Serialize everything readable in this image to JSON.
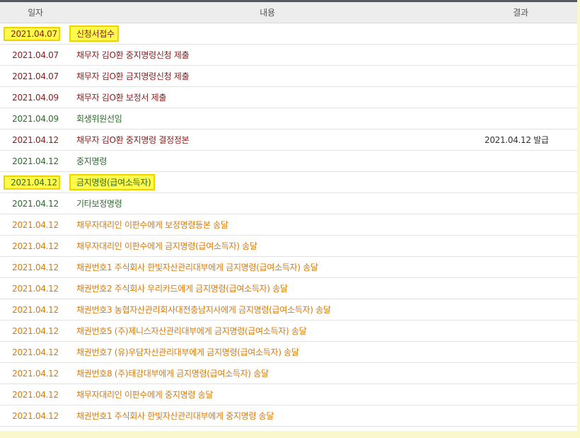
{
  "header": {
    "date": "일자",
    "content": "내용",
    "result": "결과"
  },
  "colors": {
    "red": "#8b1a1a",
    "green": "#2c6b2c",
    "orange": "#d97a0a",
    "highlight": "#fffb4a"
  },
  "rows": [
    {
      "date": "2021.04.07",
      "content": "신청서접수",
      "result": "",
      "color": "red",
      "highlighted": true
    },
    {
      "date": "2021.04.07",
      "content": "채무자 김O환 중지명령신청 제출",
      "result": "",
      "color": "red",
      "highlighted": false
    },
    {
      "date": "2021.04.07",
      "content": "채무자 김O환 금지명령신청 제출",
      "result": "",
      "color": "red",
      "highlighted": false
    },
    {
      "date": "2021.04.09",
      "content": "채무자 김O환 보정서 제출",
      "result": "",
      "color": "red",
      "highlighted": false
    },
    {
      "date": "2021.04.09",
      "content": "회생위원선임",
      "result": "",
      "color": "green",
      "highlighted": false
    },
    {
      "date": "2021.04.12",
      "content": "채무자 김O환 중지명령 결정정본",
      "result": "2021.04.12 발급",
      "color": "red",
      "highlighted": false
    },
    {
      "date": "2021.04.12",
      "content": "중지명령",
      "result": "",
      "color": "green",
      "highlighted": false
    },
    {
      "date": "2021.04.12",
      "content": "금지명령(급여소득자)",
      "result": "",
      "color": "green",
      "highlighted": true
    },
    {
      "date": "2021.04.12",
      "content": "기타보정명령",
      "result": "",
      "color": "green",
      "highlighted": false
    },
    {
      "date": "2021.04.12",
      "content": "채무자대리인 이판수에게 보정명령등본 송달",
      "result": "",
      "color": "orange",
      "highlighted": false
    },
    {
      "date": "2021.04.12",
      "content": "채무자대리인 이판수에게 금지명령(급여소득자) 송달",
      "result": "",
      "color": "orange",
      "highlighted": false
    },
    {
      "date": "2021.04.12",
      "content": "채권번호1 주식회사 한빛자산관리대부에게 금지명령(급여소득자) 송달",
      "result": "",
      "color": "orange",
      "highlighted": false
    },
    {
      "date": "2021.04.12",
      "content": "채권번호2 주식회사 우리카드에게 금지명령(급여소득자) 송달",
      "result": "",
      "color": "orange",
      "highlighted": false
    },
    {
      "date": "2021.04.12",
      "content": "채권번호3 농협자산관리회사대전충남지사에게 금지명령(급여소득자) 송달",
      "result": "",
      "color": "orange",
      "highlighted": false
    },
    {
      "date": "2021.04.12",
      "content": "채권번호5 (주)제니스자산관리대부에게 금지명령(급여소득자) 송달",
      "result": "",
      "color": "orange",
      "highlighted": false
    },
    {
      "date": "2021.04.12",
      "content": "채권번호7 (유)우담자산관리대부에게 금지명령(급여소득자) 송달",
      "result": "",
      "color": "orange",
      "highlighted": false
    },
    {
      "date": "2021.04.12",
      "content": "채권번호8 (주)태강대부에게 금지명령(급여소득자) 송달",
      "result": "",
      "color": "orange",
      "highlighted": false
    },
    {
      "date": "2021.04.12",
      "content": "채무자대리인 이판수에게 중지명령 송달",
      "result": "",
      "color": "orange",
      "highlighted": false
    },
    {
      "date": "2021.04.12",
      "content": "채권번호1 주식회사 한빛자산관리대부에게 중지명령 송달",
      "result": "",
      "color": "orange",
      "highlighted": false
    }
  ]
}
